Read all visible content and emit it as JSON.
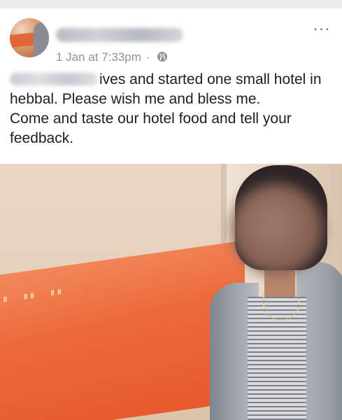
{
  "post": {
    "author_name": "",
    "timestamp": "1 Jan at 7:33pm",
    "separator": "·",
    "privacy_icon": "globe-icon",
    "more_label": "···",
    "text_line1": "ives and started one small hotel in",
    "text_line2": "hebbal. Please  wish me and bless me.",
    "text_line3": "Come and taste our hotel food and tell your",
    "text_line4": "feedback."
  },
  "colors": {
    "meta_text": "#8d949e",
    "post_text": "#1c1e21",
    "banner_orange": "#ec6a3a"
  }
}
